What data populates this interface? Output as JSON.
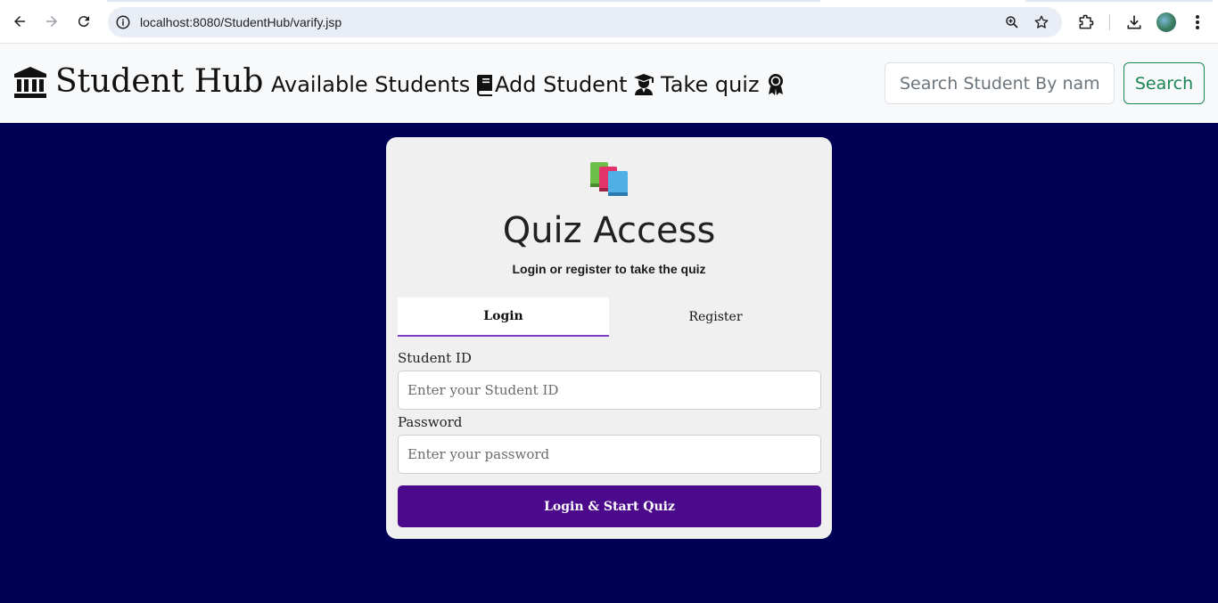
{
  "browser": {
    "url": "localhost:8080/StudentHub/varify.jsp"
  },
  "navbar": {
    "brand": "Student Hub",
    "links": [
      {
        "label": "Available Students",
        "icon": "book-icon"
      },
      {
        "label": "Add Student",
        "icon": "graduate-icon"
      },
      {
        "label": "Take quiz",
        "icon": "award-icon"
      }
    ],
    "search": {
      "placeholder": "Search Student By name",
      "button_label": "Search"
    }
  },
  "card": {
    "icon": "books-icon",
    "title": "Quiz Access",
    "subtitle": "Login or register to take the quiz",
    "tabs": [
      {
        "label": "Login",
        "active": true
      },
      {
        "label": "Register",
        "active": false
      }
    ],
    "fields": [
      {
        "label": "Student ID",
        "placeholder": "Enter your Student ID",
        "value": ""
      },
      {
        "label": "Password",
        "placeholder": "Enter your password",
        "value": ""
      }
    ],
    "submit_label": "Login & Start Quiz"
  },
  "colors": {
    "page_background": "#000055",
    "accent": "#4b0a8c",
    "search_button": "#198754"
  }
}
